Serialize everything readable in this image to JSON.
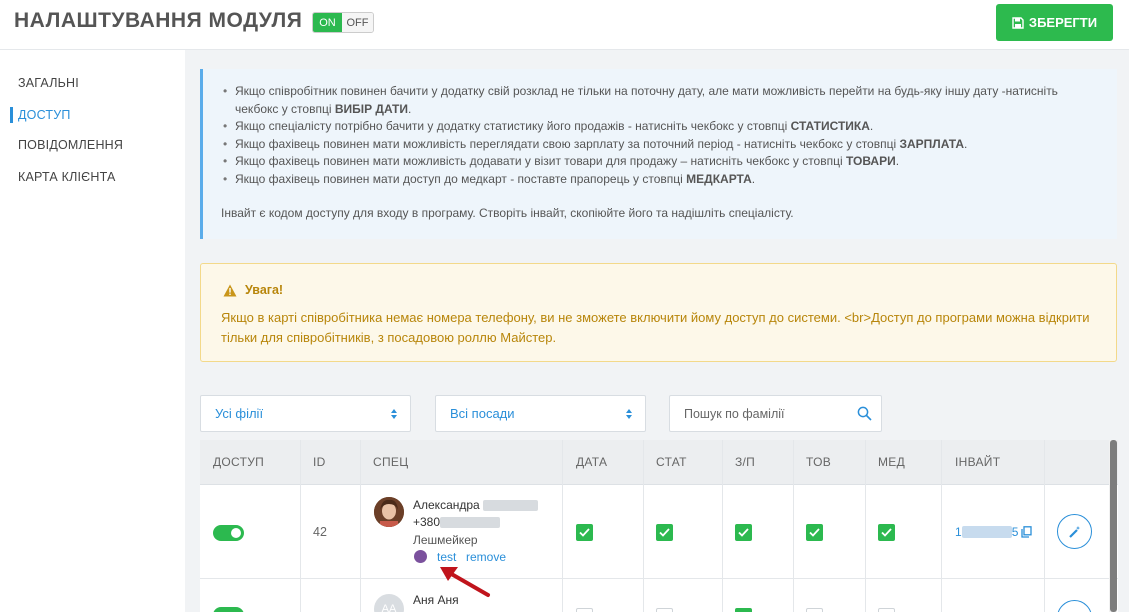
{
  "header": {
    "title": "НАЛАШТУВАННЯ МОДУЛЯ",
    "toggle_on": "ON",
    "toggle_off": "OFF",
    "save_label": "ЗБЕРЕГТИ"
  },
  "sidebar": {
    "items": [
      {
        "label": "ЗАГАЛЬНІ"
      },
      {
        "label": "ДОСТУП"
      },
      {
        "label": "ПОВІДОМЛЕННЯ"
      },
      {
        "label": "КАРТА КЛІЄНТА"
      }
    ],
    "active": "ДОСТУП"
  },
  "info": {
    "bullets": [
      {
        "pre": "Якщо співробітник повинен бачити у додатку свій розклад не тільки на поточну дату, але мати можливість перейти на будь-яку іншу дату -натисніть чекбокс у стовпці ",
        "bold": "ВИБІР ДАТИ",
        "post": "."
      },
      {
        "pre": "Якщо спеціалісту потрібно бачити у додатку статистику його продажів - натисніть чекбокс у стовпці ",
        "bold": "СТАТИСТИКА",
        "post": "."
      },
      {
        "pre": "Якщо фахівець повинен мати можливість переглядати свою зарплату за поточний період - натисніть чекбокс у стовпці ",
        "bold": "ЗАРПЛАТА",
        "post": "."
      },
      {
        "pre": "Якщо фахівець повинен мати можливість додавати у візит товари для продажу – натисніть чекбокс у стовпці ",
        "bold": "ТОВАРИ",
        "post": "."
      },
      {
        "pre": "Якщо фахівець повинен мати доступ до медкарт - поставте прапорець у стовпці ",
        "bold": "МЕДКАРТА",
        "post": "."
      }
    ],
    "invite_note": "Інвайт є кодом доступу для входу в програму. Створіть інвайт, скопіюйте його та надішліть спеціалісту."
  },
  "warning": {
    "title": "Увага!",
    "text": "Якщо в карті співробітника немає номера телефону, ви не зможете включити йому доступ до системи. <br>Доступ до програми можна відкрити тільки для співробітників, з посадовою роллю Майстер."
  },
  "filters": {
    "branch": "Усі філії",
    "position": "Всі посади",
    "search_placeholder": "Пошук по фамілії"
  },
  "table": {
    "headers": [
      "ДОСТУП",
      "ID",
      "СПЕЦ",
      "ДАТА",
      "СТАТ",
      "З/П",
      "ТОВ",
      "МЕД",
      "ІНВАЙТ"
    ],
    "rows": [
      {
        "access": true,
        "id": "42",
        "name": "Александра",
        "phone_prefix": "+380",
        "role": "Лешмейкер",
        "links": [
          "test",
          "remove"
        ],
        "date": true,
        "stat": true,
        "salary": true,
        "goods": true,
        "med": true,
        "invite_prefix": "1",
        "invite_suffix": "5"
      },
      {
        "access": true,
        "initials": "АА",
        "name": "Аня Аня"
      }
    ]
  },
  "colors": {
    "accent": "#2a8fd9",
    "success": "#2cb94f",
    "warning_text": "#b8860b",
    "arrow": "#c0141c"
  }
}
